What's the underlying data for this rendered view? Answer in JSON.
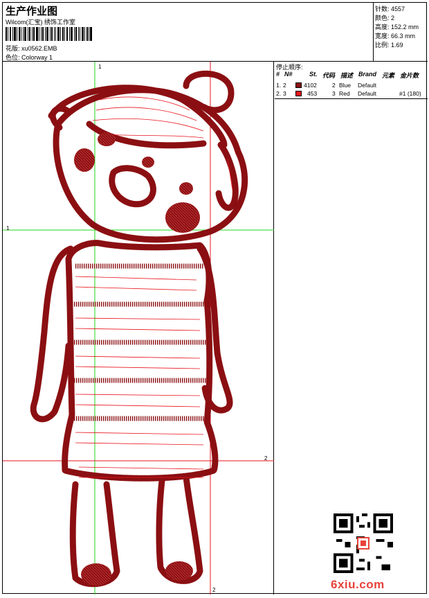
{
  "header": {
    "title": "生产作业图",
    "subtitle": "Wilcom(汇宝) 绣饰工作室",
    "pattern_label": "花版:",
    "pattern_value": "xu0562.EMB",
    "colorway_label": "色位:",
    "colorway_value": "Colorway 1"
  },
  "stats": [
    {
      "label": "针数:",
      "value": "4557"
    },
    {
      "label": "颜色:",
      "value": "2"
    },
    {
      "label": "高度:",
      "value": "152.2 mm"
    },
    {
      "label": "宽度:",
      "value": "66.3 mm"
    },
    {
      "label": "比例:",
      "value": "1.69"
    }
  ],
  "legend": {
    "title": "停止顺序:",
    "headers": [
      "#",
      "N#",
      "St.",
      "代码",
      "描述",
      "Brand",
      "元素",
      "金片数"
    ],
    "rows": [
      {
        "num": "1.",
        "n": "2",
        "color": "#8b0f12",
        "st": "4102",
        "code": "2",
        "desc": "Blue",
        "brand": "Default",
        "elem": "",
        "seq": ""
      },
      {
        "num": "2.",
        "n": "3",
        "color": "#e8141c",
        "st": "453",
        "code": "3",
        "desc": "Red",
        "brand": "Default",
        "elem": "",
        "seq": "#1 (180)"
      }
    ]
  },
  "axes": {
    "green_v": "1",
    "green_h": "1",
    "red_v": "2",
    "red_h": "2"
  },
  "colors": {
    "stitch_dark": "#8b0f12",
    "stitch_red": "#e8141c",
    "guide_green": "#22d41a",
    "guide_red": "#e8141c"
  },
  "watermark": "6xiu.com"
}
